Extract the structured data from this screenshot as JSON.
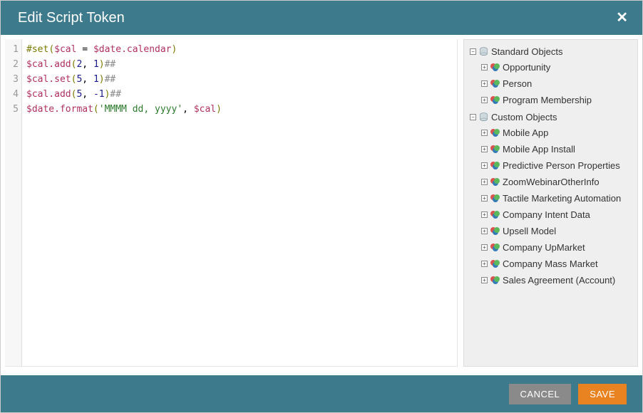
{
  "dialog": {
    "title": "Edit Script Token"
  },
  "footer": {
    "cancel_label": "CANCEL",
    "save_label": "SAVE"
  },
  "editor": {
    "line_numbers": [
      "1",
      "2",
      "3",
      "4",
      "5"
    ],
    "lines": [
      {
        "tokens": [
          {
            "t": "#set",
            "c": "tok-kw"
          },
          {
            "t": "(",
            "c": "tok-paren"
          },
          {
            "t": "$cal",
            "c": "tok-var"
          },
          {
            "t": " = ",
            "c": ""
          },
          {
            "t": "$date.calendar",
            "c": "tok-var"
          },
          {
            "t": ")",
            "c": "tok-paren"
          }
        ]
      },
      {
        "tokens": [
          {
            "t": "$cal.add",
            "c": "tok-fn"
          },
          {
            "t": "(",
            "c": "tok-paren"
          },
          {
            "t": "2",
            "c": "tok-num"
          },
          {
            "t": ", ",
            "c": ""
          },
          {
            "t": "1",
            "c": "tok-num"
          },
          {
            "t": ")",
            "c": "tok-paren"
          },
          {
            "t": "##",
            "c": "tok-comment"
          }
        ]
      },
      {
        "tokens": [
          {
            "t": "$cal.set",
            "c": "tok-fn"
          },
          {
            "t": "(",
            "c": "tok-paren"
          },
          {
            "t": "5",
            "c": "tok-num"
          },
          {
            "t": ", ",
            "c": ""
          },
          {
            "t": "1",
            "c": "tok-num"
          },
          {
            "t": ")",
            "c": "tok-paren"
          },
          {
            "t": "##",
            "c": "tok-comment"
          }
        ]
      },
      {
        "tokens": [
          {
            "t": "$cal.add",
            "c": "tok-fn"
          },
          {
            "t": "(",
            "c": "tok-paren"
          },
          {
            "t": "5",
            "c": "tok-num"
          },
          {
            "t": ", ",
            "c": ""
          },
          {
            "t": "-1",
            "c": "tok-num"
          },
          {
            "t": ")",
            "c": "tok-paren"
          },
          {
            "t": "##",
            "c": "tok-comment"
          }
        ]
      },
      {
        "tokens": [
          {
            "t": "$date.format",
            "c": "tok-fn"
          },
          {
            "t": "(",
            "c": "tok-paren"
          },
          {
            "t": "'MMMM dd, yyyy'",
            "c": "tok-str"
          },
          {
            "t": ", ",
            "c": ""
          },
          {
            "t": "$cal",
            "c": "tok-var"
          },
          {
            "t": ")",
            "c": "tok-paren"
          }
        ]
      }
    ]
  },
  "tree": {
    "groups": [
      {
        "label": "Standard Objects",
        "expanded": true,
        "items": [
          "Opportunity",
          "Person",
          "Program Membership"
        ]
      },
      {
        "label": "Custom Objects",
        "expanded": true,
        "items": [
          "Mobile App",
          "Mobile App Install",
          "Predictive Person Properties",
          "ZoomWebinarOtherInfo",
          "Tactile Marketing Automation",
          "Company Intent Data",
          "Upsell Model",
          "Company UpMarket",
          "Company Mass Market",
          "Sales Agreement (Account)"
        ]
      }
    ]
  }
}
